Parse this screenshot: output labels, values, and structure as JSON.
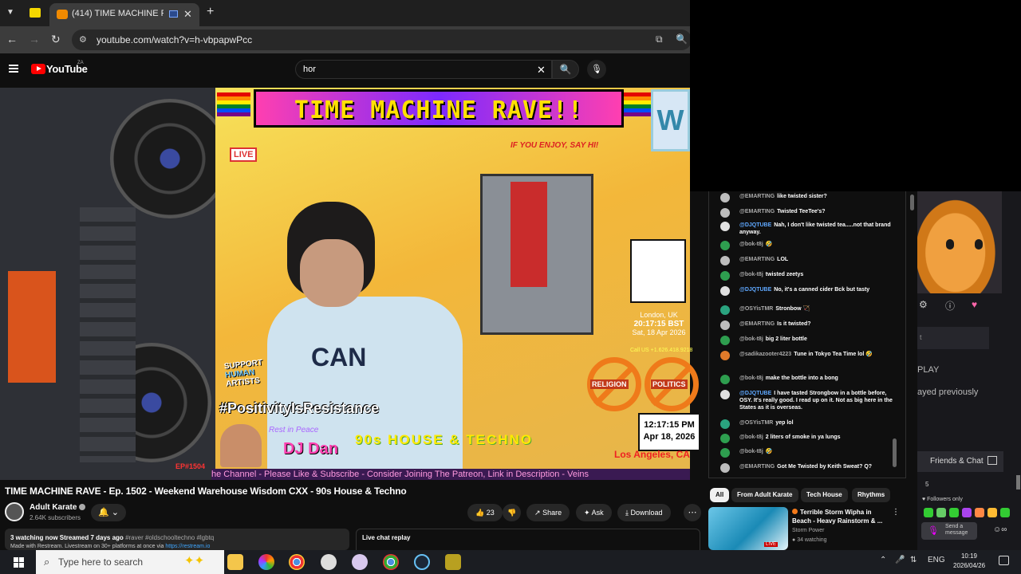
{
  "browser": {
    "tab_title": "(414) TIME MACHINE RAVE",
    "url": "youtube.com/watch?v=h-vbpapwPcc",
    "new_tab_symbol": "+"
  },
  "youtube": {
    "logo_text": "YouTube",
    "country_code": "ZA",
    "search_value": "hor"
  },
  "video_overlay": {
    "banner": "TIME MACHINE RAVE!!",
    "live_tag": "LIVE",
    "enjoy_text": "IF YOU ENJOY, SAY HI!",
    "london_label": "London, UK",
    "london_time": "20:17:15 BST",
    "london_date": "Sat, 18 Apr 2026",
    "phone": "Call US +1.626.418.9218",
    "no_religion": "RELIGION",
    "no_politics": "POLITICS",
    "la_time": "12:17:15 PM",
    "la_date": "Apr 18, 2026",
    "la_label": "Los Angeles, CA",
    "support_line1": "SUPPORT",
    "support_line2": "HUMAN",
    "support_line3": "ARTISTS",
    "positivity": "#PositivityIsResistance",
    "rest_in_peace": "Rest in Peace",
    "dj_name": "DJ Dan",
    "genre": "90s HOUSE & TECHNO",
    "episode": "EP#1504",
    "ticker": "he Channel - Please Like & Subscribe - Consider Joining The Patreon, Link in Description - Veins"
  },
  "video": {
    "title": "TIME MACHINE RAVE - Ep. 1502 - Weekend Warehouse Wisdom CXX - 90s House & Techno",
    "channel": "Adult Karate",
    "subscribers": "2.64K subscribers",
    "likes": "23",
    "share_label": "Share",
    "ask_label": "Ask",
    "download_label": "Download",
    "stats": "3 watching now  Streamed 7 days ago",
    "hashtags": "#raver #oldschooltechno #lgbtq",
    "desc_line2": "Made with Restream. Livestream on 30+ platforms at once via",
    "desc_link": "https://restream.io",
    "chat_replay_label": "Live chat replay"
  },
  "chat": {
    "messages": [
      {
        "author": "@EMARTING",
        "text": "like twisted sister?",
        "blue": false,
        "avatar": "#bdbdbd"
      },
      {
        "author": "@EMARTING",
        "text": "Twisted TeeTee's?",
        "blue": false,
        "avatar": "#bdbdbd"
      },
      {
        "author": "@DJQTUBE",
        "text": "Nah, I don't like twisted tea.....not that brand anyway.",
        "blue": true,
        "avatar": "#e0e0e0"
      },
      {
        "author": "@bok-t8j",
        "text": "🤣",
        "blue": false,
        "avatar": "#2e9e4f"
      },
      {
        "author": "@EMARTING",
        "text": "LOL",
        "blue": false,
        "avatar": "#bdbdbd"
      },
      {
        "author": "@bok-t8j",
        "text": "twisted zeetys",
        "blue": false,
        "avatar": "#2e9e4f"
      },
      {
        "author": "@DJQTUBE",
        "text": "No, it's a canned cider Bck but tasty",
        "blue": true,
        "avatar": "#e0e0e0"
      },
      {
        "author": "@OSYisTMR",
        "text": "Stronbow 🏹",
        "blue": false,
        "avatar": "#2aa37f"
      },
      {
        "author": "@EMARTING",
        "text": "Is it twisted?",
        "blue": false,
        "avatar": "#bdbdbd"
      },
      {
        "author": "@bok-t8j",
        "text": "big 2 liter bottle",
        "blue": false,
        "avatar": "#2e9e4f"
      },
      {
        "author": "@sadikazooter4223",
        "text": "Tune in Tokyo Tea Time lol 🤣",
        "blue": false,
        "avatar": "#e07a2a"
      },
      {
        "author": "@bok-t8j",
        "text": "make the bottle into a bong",
        "blue": false,
        "avatar": "#2e9e4f"
      },
      {
        "author": "@DJQTUBE",
        "text": "I have tasted Strongbow in a bottle before, OSY. It's really good. I read up on it. Not as big here in the States as it is overseas.",
        "blue": true,
        "avatar": "#e0e0e0"
      },
      {
        "author": "@OSYisTMR",
        "text": "yep lol",
        "blue": false,
        "avatar": "#2aa37f"
      },
      {
        "author": "@bok-t8j",
        "text": "2 liters of smoke in ya lungs",
        "blue": false,
        "avatar": "#2e9e4f"
      },
      {
        "author": "@bok-t8j",
        "text": "🤣",
        "blue": false,
        "avatar": "#2e9e4f"
      },
      {
        "author": "@EMARTING",
        "text": "Got Me Twisted by Keith Sweat? Q?",
        "blue": false,
        "avatar": "#bdbdbd"
      }
    ]
  },
  "chips": [
    "All",
    "From Adult Karate",
    "Tech House",
    "Rhythms"
  ],
  "suggestion": {
    "title": "Terrible Storm Wipha in Beach - Heavy Rainstorm & ...",
    "channel": "Storm Power",
    "watching": "34 watching",
    "live_badge": "LIVE"
  },
  "side_app": {
    "play_label": "PLAY",
    "played_label": "ayed previously",
    "friends_label": "Friends & Chat",
    "count": "5",
    "followers_only": "♥ Followers only",
    "send_message": "Send a message",
    "box_text": "t"
  },
  "taskbar": {
    "search_placeholder": "Type here to search",
    "language": "ENG",
    "time": "10:19",
    "date": "2026/04/26"
  },
  "colors": {
    "yt_red": "#ff0000",
    "chat_blue": "#5fa8ff",
    "banner_yellow": "#ffe100"
  }
}
